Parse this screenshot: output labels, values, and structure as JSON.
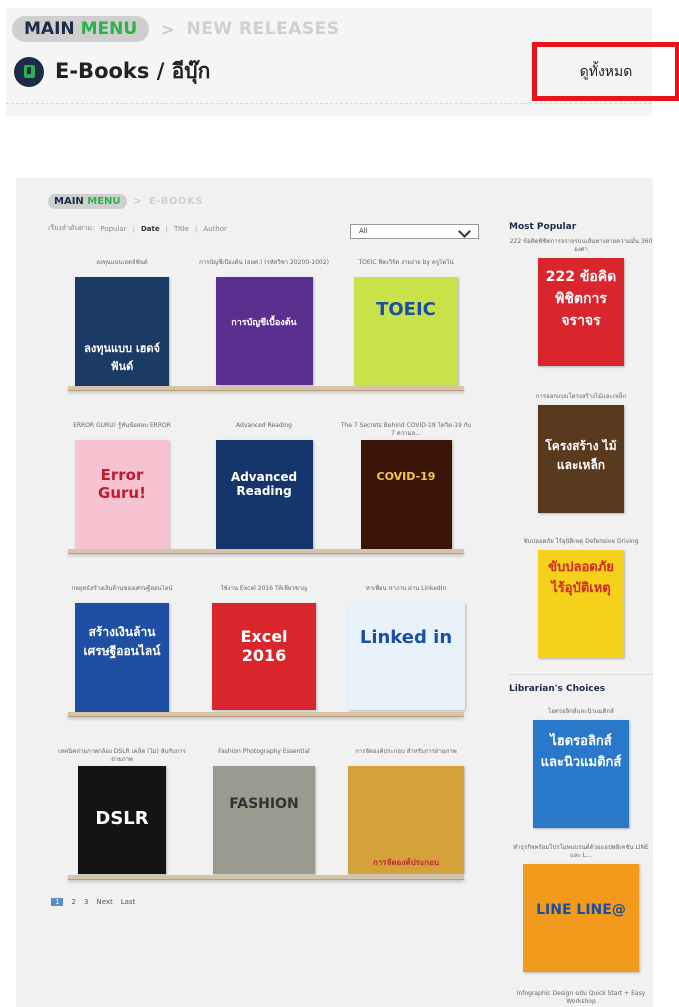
{
  "header": {
    "crumb_main_a": "MAIN",
    "crumb_main_b": "MENU",
    "crumb_sep": ">",
    "crumb_current": "NEW RELEASES",
    "section_title": "E-Books / อีบุ๊ก",
    "view_all": "ดูทั้งหมด"
  },
  "embedded": {
    "crumb_main_a": "MAIN",
    "crumb_main_b": "MENU",
    "crumb_sep": ">",
    "crumb_current": "E-BOOKS",
    "sort_label": "เรียงลำดับตาม:",
    "sort_options": [
      "Popular",
      "Date",
      "Title",
      "Author"
    ],
    "sort_divider": "|",
    "filter_value": "All",
    "books": [
      {
        "title": "ลงทุนแบบเฮดจ์ฟันด์",
        "cover_text": "ลงทุนแบบ เฮดจ์ฟันด์",
        "cover_bg": "#1b3a66"
      },
      {
        "title": "การบัญชีเบื้องต้น (สอศ.) (รหัสวิชา 20200-1002)",
        "cover_text": "การบัญชีเบื้องต้น",
        "cover_bg": "#5a2f8f"
      },
      {
        "title": "TOEIC ฟิตเวิร์ด ง่ายง่าย by ครูโดโน่",
        "cover_text": "TOEIC",
        "cover_bg": "#c9e24a"
      },
      {
        "title": "ERROR GURU! รู้ทันข้อสอบ ERROR",
        "cover_text": "Error Guru!",
        "cover_bg": "#f7c3d1"
      },
      {
        "title": "Advanced Reading",
        "cover_text": "Advanced Reading",
        "cover_bg": "#14366b"
      },
      {
        "title": "The 7 Secrets Behind COVID-19 โควิด-19 กับ 7 ความล...",
        "cover_text": "COVID-19",
        "cover_bg": "#3a1508"
      },
      {
        "title": "กลยุทธ์สร้างเงินล้านของเศรษฐีออนไลน์",
        "cover_text": "สร้างเงินล้าน เศรษฐีออนไลน์",
        "cover_bg": "#1f4fa3"
      },
      {
        "title": "ใช้งาน Excel 2016 ให้เชี่ยวชาญ",
        "cover_text": "Excel 2016",
        "cover_bg": "#d8262c"
      },
      {
        "title": "หาเพื่อน หางาน ผ่าน LinkedIn",
        "cover_text": "Linked in",
        "cover_bg": "#e8f2fb"
      },
      {
        "title": "เทคนิคถ่ายภาพกล้อง DSLR เคล็ด (ไม่) ลับกับการถ่ายภาพ",
        "cover_text": "DSLR",
        "cover_bg": "#141414"
      },
      {
        "title": "Fashion Photography Essential",
        "cover_text": "FASHION",
        "cover_bg": "#9a9a8e"
      },
      {
        "title": "การจัดองค์ประกอบ สำหรับการถ่ายภาพ",
        "cover_text": "การจัดองค์ประกอบ",
        "cover_bg": "#d4a13a"
      }
    ],
    "pager": [
      "1",
      "2",
      "3",
      "Next",
      "Last"
    ],
    "sidebar": {
      "popular_title": "Most Popular",
      "choices_title": "Librarian's Choices",
      "popular": [
        {
          "title": "222 ข้อคิดพิชิตการจราจรบนเส้นทางสายความมั่น 360 องศา",
          "cover_text": "222 ข้อคิด พิชิตการจราจร",
          "cover_bg": "#d8262c"
        },
        {
          "title": "การออกแบบโครงสร้างไม้และเหล็ก",
          "cover_text": "โครงสร้าง ไม้ และเหล็ก",
          "cover_bg": "#5a3a1e"
        },
        {
          "title": "ขับปลอดภัย ไร้อุบัติเหตุ Defensive Driving",
          "cover_text": "ขับปลอดภัย ไร้อุบัติเหตุ",
          "cover_bg": "#f4d11b"
        }
      ],
      "choices": [
        {
          "title": "ไฮดรอลิกส์และนิวแมติกส์",
          "cover_text": "ไฮดรอลิกส์ และนิวแมติกส์",
          "cover_bg": "#2a78c9"
        },
        {
          "title": "ทำธุรกิจพร้อมโปรโมทแบรนด์ด้วยแอปพลิเคชัน LINE และ L...",
          "cover_text": "LINE LINE@",
          "cover_bg": "#f29a1c"
        },
        {
          "title": "Infographic Design ฉบับ Quick Start + Easy Workshop",
          "cover_text": "",
          "cover_bg": "#ffffff"
        }
      ]
    }
  }
}
